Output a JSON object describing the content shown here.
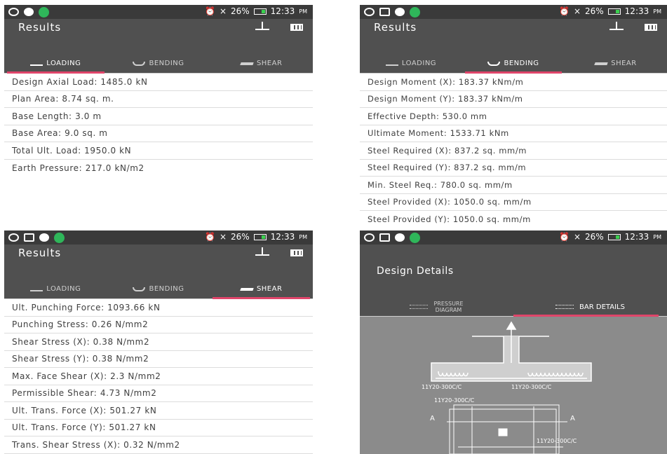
{
  "status_bar": {
    "battery": "26%",
    "time": "12:33",
    "ampm": "PM",
    "signal": "×"
  },
  "results_app": {
    "title": "Results",
    "tabs": {
      "loading": "LOADING",
      "bending": "BENDING",
      "shear": "SHEAR"
    }
  },
  "loading_panel": {
    "rows": [
      "Design Axial Load: 1485.0 kN",
      "Plan Area: 8.74 sq. m.",
      "Base Length: 3.0 m",
      "Base Area: 9.0 sq. m",
      "Total Ult. Load: 1950.0 kN",
      "Earth Pressure: 217.0 kN/m2"
    ]
  },
  "bending_panel": {
    "rows": [
      "Design Moment (X): 183.37 kNm/m",
      "Design Moment (Y): 183.37 kNm/m",
      "Effective Depth: 530.0 mm",
      "Ultimate Moment: 1533.71 kNm",
      "Steel Required (X): 837.2 sq. mm/m",
      "Steel Required (Y): 837.2 sq. mm/m",
      "Min. Steel Req.: 780.0 sq. mm/m",
      "Steel Provided (X): 1050.0 sq. mm/m",
      "Steel Provided (Y): 1050.0 sq. mm/m"
    ]
  },
  "shear_panel": {
    "rows": [
      "Ult. Punching Force: 1093.66 kN",
      "Punching Stress: 0.26 N/mm2",
      "Shear Stress (X): 0.38 N/mm2",
      "Shear Stress (Y): 0.38 N/mm2",
      "Max. Face Shear (X): 2.3 N/mm2",
      "Permissible Shear: 4.73 N/mm2",
      "Ult. Trans. Force (X): 501.27 kN",
      "Ult. Trans. Force (Y): 501.27 kN",
      "Trans. Shear Stress (X): 0.32 N/mm2"
    ]
  },
  "design_details": {
    "title": "Design Details",
    "tab_pressure_line1": "PRESSURE",
    "tab_pressure_line2": "DIAGRAM",
    "tab_bar": "BAR DETAILS",
    "bar_label_1": "11Y20-300C/C",
    "bar_label_2": "11Y20-300C/C",
    "bar_label_3": "11Y20-300C/C",
    "bar_label_4": "11Y20-300C/C",
    "section_mark": "A"
  },
  "colors": {
    "accent": "#e0456a",
    "appbar": "#505050",
    "statusbar": "#3a3a3a",
    "drawing_bg": "#8b8b8b"
  }
}
